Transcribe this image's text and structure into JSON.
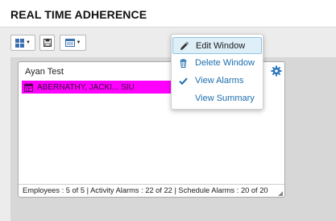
{
  "header": {
    "title": "REAL TIME ADHERENCE"
  },
  "toolbar": {
    "layout_icon": "grid-icon",
    "save_icon": "save-icon",
    "view_icon": "window-icon",
    "caret_glyph": "▼"
  },
  "widget": {
    "title": "Ayan Test",
    "employees": [
      {
        "name": "ABERNATHY, JACKI...  SIU",
        "color": "#ff00ff",
        "icon": "calendar-icon"
      }
    ],
    "footer": "Employees : 5 of 5 | Activity Alarms : 22 of 22 | Schedule Alarms : 20 of 20"
  },
  "menu": {
    "items": [
      {
        "label": "Edit Window",
        "icon": "pencil-icon",
        "highlighted": true
      },
      {
        "label": "Delete Window",
        "icon": "trash-icon"
      },
      {
        "label": "View Alarms",
        "icon": "check-icon"
      },
      {
        "label": "View Summary",
        "icon": ""
      }
    ]
  },
  "colors": {
    "accent": "#1d6fae",
    "highlight": "#ff00ff",
    "menu_hover": "#deeff8"
  }
}
